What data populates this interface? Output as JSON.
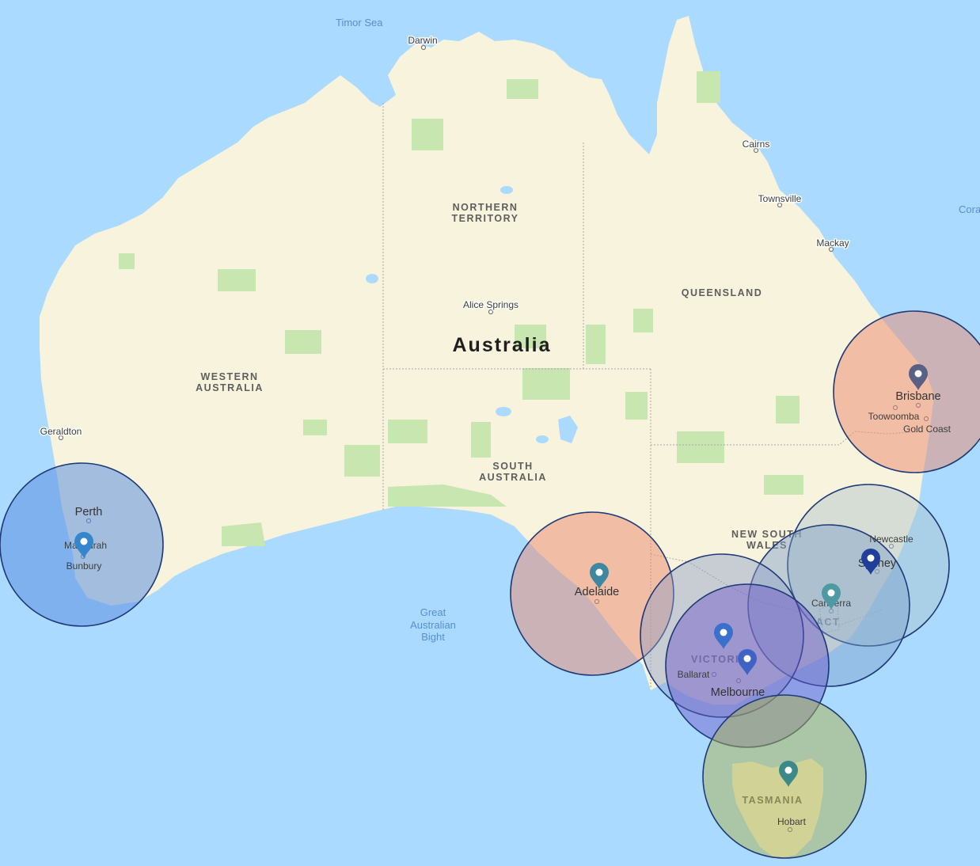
{
  "map": {
    "country": "Australia",
    "water_labels": {
      "timor_sea": "Timor Sea",
      "coral": "Cora",
      "bight": [
        "Great",
        "Australian",
        "Bight"
      ]
    },
    "regions": {
      "nt": [
        "NORTHERN",
        "TERRITORY"
      ],
      "wa": [
        "WESTERN",
        "AUSTRALIA"
      ],
      "sa": [
        "SOUTH",
        "AUSTRALIA"
      ],
      "qld": "QUEENSLAND",
      "nsw": [
        "NEW SOUTH",
        "WALES"
      ],
      "vic": "VICTORIA",
      "act": "ACT",
      "tas": "TASMANIA"
    },
    "cities": {
      "darwin": "Darwin",
      "cairns": "Cairns",
      "townsville": "Townsville",
      "mackay": "Mackay",
      "alice_springs": "Alice Springs",
      "geraldton": "Geraldton",
      "perth": "Perth",
      "mandurah": "Mandurah",
      "bunbury": "Bunbury",
      "brisbane": "Brisbane",
      "toowoomba": "Toowoomba",
      "gold_coast": "Gold Coast",
      "newcastle": "Newcastle",
      "sydney": "Sydney",
      "canberra": "Canberra",
      "adelaide": "Adelaide",
      "ballarat": "Ballarat",
      "melbourne": "Melbourne",
      "hobart": "Hobart"
    },
    "colors": {
      "water": "#aadaff",
      "land": "#f8f3dc",
      "park": "#c8e6b0",
      "circle_stroke": "#1f3a78",
      "perth_fill": "#5b8fe0",
      "brisbane_fill": "#e98a6e",
      "adelaide_fill": "#e98a6e",
      "sydney_fill": "#aac3cb",
      "canberra_fill": "#7c9dc8",
      "ballarat_fill": "#8f9fc7",
      "melbourne_fill": "#6a55c8",
      "tasmania_fill": "#a9b24e",
      "pin_perth": "#3586cc",
      "pin_brisbane": "#5a5f84",
      "pin_adelaide": "#3f86a0",
      "pin_sydney": "#1f3f9a",
      "pin_canberra": "#4d9aa3",
      "pin_ballarat": "#3a70cc",
      "pin_melbourne": "#3e63c4",
      "pin_tasmania": "#3c8a87"
    },
    "markers": [
      {
        "id": "perth",
        "icon": "map-pin-icon"
      },
      {
        "id": "brisbane",
        "icon": "map-pin-icon"
      },
      {
        "id": "adelaide",
        "icon": "map-pin-icon"
      },
      {
        "id": "sydney",
        "icon": "map-pin-icon"
      },
      {
        "id": "canberra",
        "icon": "map-pin-icon"
      },
      {
        "id": "ballarat",
        "icon": "map-pin-icon"
      },
      {
        "id": "melbourne",
        "icon": "map-pin-icon"
      },
      {
        "id": "tasmania",
        "icon": "map-pin-icon"
      }
    ]
  }
}
